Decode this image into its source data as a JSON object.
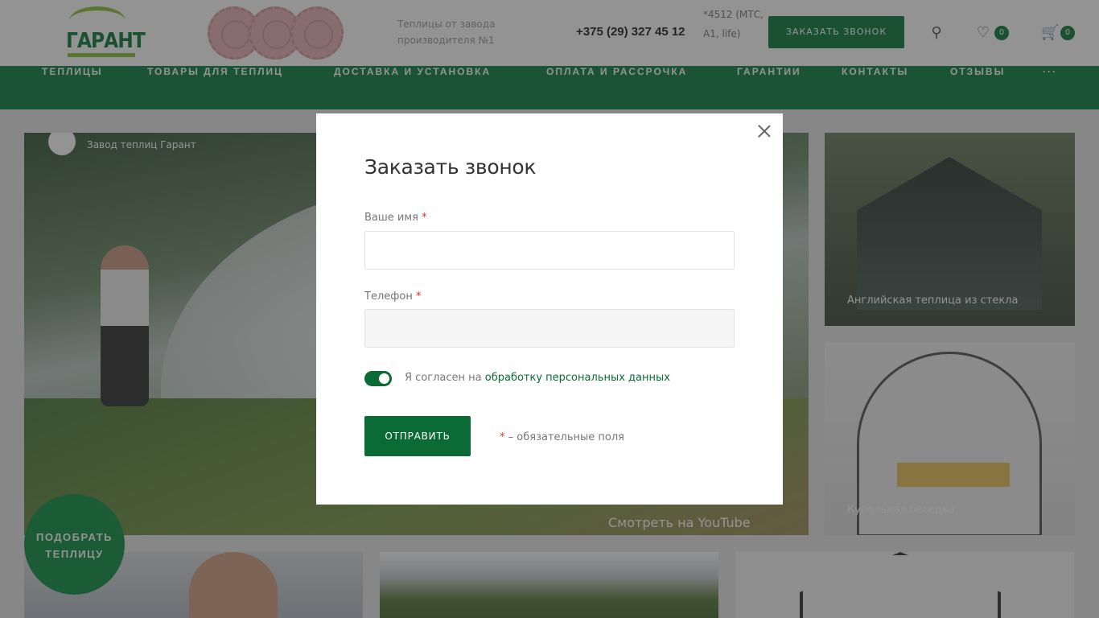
{
  "header": {
    "logo_text": "ГАРАНТ",
    "tagline": "Теплицы от завода производителя №1",
    "phone": "+375 (29) 327 45 12",
    "operator": "*4512 (МТС, A1, life)",
    "callback_label": "ЗАКАЗАТЬ ЗВОНОК",
    "favorites_count": "0",
    "cart_count": "0"
  },
  "nav": {
    "items": [
      "ТЕПЛИЦЫ",
      "ТОВАРЫ ДЛЯ ТЕПЛИЦ",
      "ДОСТАВКА И УСТАНОВКА",
      "ОПЛАТА И РАССРОЧКА",
      "ГАРАНТИИ",
      "КОНТАКТЫ",
      "ОТЗЫВЫ",
      "···"
    ]
  },
  "tiles": {
    "hero_channel": "Завод теплиц Гарант",
    "hero_youtube": "Смотреть на YouTube",
    "side1_caption": "Английская теплица из стекла",
    "side2_caption": "Купольная беседка"
  },
  "pick_button": {
    "line1": "ПОДОБРАТЬ",
    "line2": "ТЕПЛИЦУ"
  },
  "modal": {
    "title": "Заказать звонок",
    "name_label": "Ваше имя",
    "name_value": "",
    "phone_label": "Телефон",
    "phone_value": "",
    "required_mark": "*",
    "consent_text": "Я согласен на ",
    "consent_link": "обработку персональных данных",
    "consent_checked": true,
    "submit_label": "ОТПРАВИТЬ",
    "required_note": "– обязательные поля"
  },
  "colors": {
    "brand_green": "#0a6b34",
    "nav_green": "#0e8142",
    "required_red": "#e53030"
  }
}
